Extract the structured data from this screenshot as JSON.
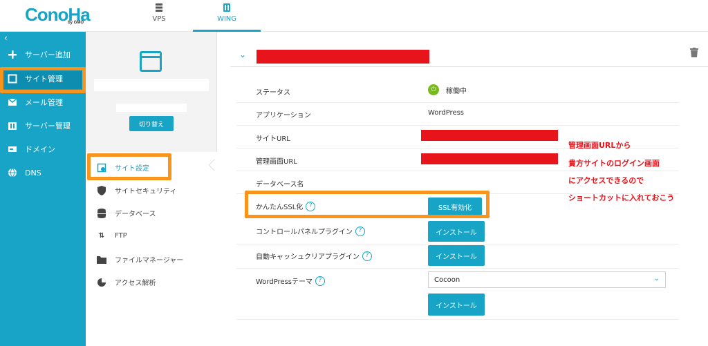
{
  "brand": {
    "logo": "ConoHa",
    "logo_sub": "by GMO"
  },
  "top_tabs": [
    {
      "label": "VPS",
      "icon": "server-icon",
      "active": false
    },
    {
      "label": "WING",
      "icon": "wing-icon",
      "active": true
    }
  ],
  "leftnav": {
    "collapse": "‹",
    "items": [
      {
        "label": "サーバー追加",
        "icon": "plus-icon"
      },
      {
        "label": "サイト管理",
        "icon": "window-icon",
        "active": true
      },
      {
        "label": "メール管理",
        "icon": "mail-icon"
      },
      {
        "label": "サーバー管理",
        "icon": "server-manage-icon"
      },
      {
        "label": "ドメイン",
        "icon": "domain-icon"
      },
      {
        "label": "DNS",
        "icon": "globe-icon"
      }
    ]
  },
  "subpanel": {
    "switch_label": "切り替え",
    "items": [
      {
        "label": "サイト設定",
        "icon": "site-settings-icon",
        "active": true
      },
      {
        "label": "サイトセキュリティ",
        "icon": "shield-icon"
      },
      {
        "label": "データベース",
        "icon": "database-icon"
      },
      {
        "label": "FTP",
        "icon": "transfer-icon"
      },
      {
        "label": "ファイルマネージャー",
        "icon": "folder-icon"
      },
      {
        "label": "アクセス解析",
        "icon": "pie-chart-icon"
      }
    ]
  },
  "main": {
    "rows": {
      "status_label": "ステータス",
      "status_value": "稼働中",
      "app_label": "アプリケーション",
      "app_value": "WordPress",
      "site_url_label": "サイトURL",
      "admin_url_label": "管理画面URL",
      "db_name_label": "データベース名",
      "ssl_label": "かんたんSSL化",
      "ssl_button": "SSL有効化",
      "cp_plugin_label": "コントロールパネルプラグイン",
      "cache_plugin_label": "自動キャッシュクリアプラグイン",
      "wp_theme_label": "WordPressテーマ",
      "wp_theme_value": "Cocoon",
      "install_label": "インストール"
    }
  },
  "annotation": {
    "lines": [
      "管理画面URLから",
      "貴方サイトのログイン画面",
      "にアクセスできるので",
      "ショートカットに入れておこう"
    ]
  },
  "colors": {
    "accent": "#17a4c7",
    "highlight": "#f7941d",
    "redaction": "#e8141b",
    "status": "#78b91c"
  }
}
